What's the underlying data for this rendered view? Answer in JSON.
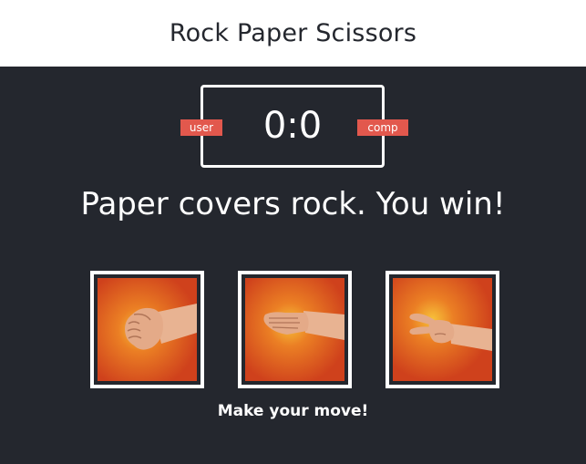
{
  "header": {
    "title": "Rock Paper Scissors"
  },
  "scoreboard": {
    "user_label": "user",
    "comp_label": "comp",
    "score": "0:0"
  },
  "result_message": "Paper covers rock. You win!",
  "choices": [
    {
      "id": "rock",
      "icon": "rock-hand-icon"
    },
    {
      "id": "paper",
      "icon": "paper-hand-icon"
    },
    {
      "id": "scissors",
      "icon": "scissors-hand-icon"
    }
  ],
  "prompt": "Make your move!",
  "colors": {
    "background": "#24272e",
    "header_bg": "#ffffff",
    "badge": "#e2584d",
    "tile_bg": "#d9461f",
    "tile_glow": "#f7c23a"
  }
}
